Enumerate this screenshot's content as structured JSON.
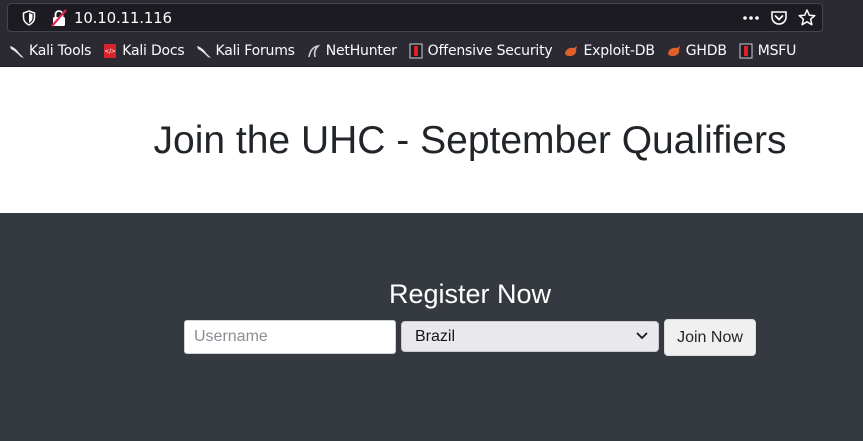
{
  "browser": {
    "url": "10.10.11.116",
    "bookmarks": [
      {
        "label": "Kali Tools",
        "icon": "kali-dragon-icon"
      },
      {
        "label": "Kali Docs",
        "icon": "kali-docs-icon"
      },
      {
        "label": "Kali Forums",
        "icon": "kali-dragon-icon"
      },
      {
        "label": "NetHunter",
        "icon": "nethunter-icon"
      },
      {
        "label": "Offensive Security",
        "icon": "offsec-icon"
      },
      {
        "label": "Exploit-DB",
        "icon": "exploitdb-icon"
      },
      {
        "label": "GHDB",
        "icon": "exploitdb-icon"
      },
      {
        "label": "MSFU",
        "icon": "offsec-icon"
      }
    ]
  },
  "hero": {
    "title": "Join the UHC - September Qualifiers"
  },
  "register": {
    "heading": "Register Now",
    "username_placeholder": "Username",
    "country_selected": "Brazil",
    "submit_label": "Join Now"
  },
  "colors": {
    "hero_bg": "#ffffff",
    "section_bg": "#343a40",
    "chrome_bg": "#2b2a33"
  }
}
